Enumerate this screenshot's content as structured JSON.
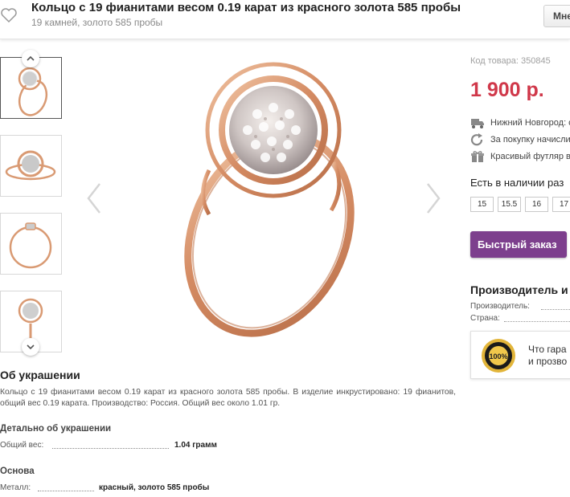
{
  "header": {
    "title": "Кольцо с 19 фианитами весом 0.19 карат из красного золота 585 пробы",
    "subtitle": "19 камней, золото 585 пробы",
    "menu_label": "Мне"
  },
  "gallery": {
    "thumbnails": [
      "thumb-1",
      "thumb-2",
      "thumb-3",
      "thumb-4"
    ],
    "active_index": 0
  },
  "product": {
    "sku_label": "Код товара: 350845",
    "price": "1 900 р.",
    "features": [
      {
        "icon": "truck-icon",
        "text": "Нижний Новгород: с"
      },
      {
        "icon": "refresh-icon",
        "text": "За покупку начисли"
      },
      {
        "icon": "gift-icon",
        "text": "Красивый футляр в"
      }
    ],
    "availability_label": "Есть в наличии раз",
    "sizes": [
      "15",
      "15.5",
      "16",
      "17"
    ],
    "quick_order_label": "Быстрый заказ"
  },
  "manufacturer": {
    "title": "Производитель и",
    "rows": [
      {
        "label": "Производитель:"
      },
      {
        "label": "Страна:"
      }
    ]
  },
  "guarantee": {
    "line1": "Что гара",
    "line2": "и прозво",
    "seal_text": "100%"
  },
  "about": {
    "title": "Об украшении",
    "text": "Кольцо с 19 фианитами весом 0.19 карат из красного золота 585 пробы. В изделие инкрустировано: 19 фианитов, общий вес 0.19 карата. Производство: Россия. Общий вес около 1.01 гр.",
    "details_title": "Детально об украшении",
    "weight_label": "Общий вес:",
    "weight_value": "1.04 грамм",
    "base_title": "Основа",
    "metal_label": "Металл:",
    "metal_value": "красный, золото 585 пробы"
  },
  "colors": {
    "price": "#d0384a",
    "quick_order": "#7d3f8d",
    "gold": "#d99a73"
  }
}
